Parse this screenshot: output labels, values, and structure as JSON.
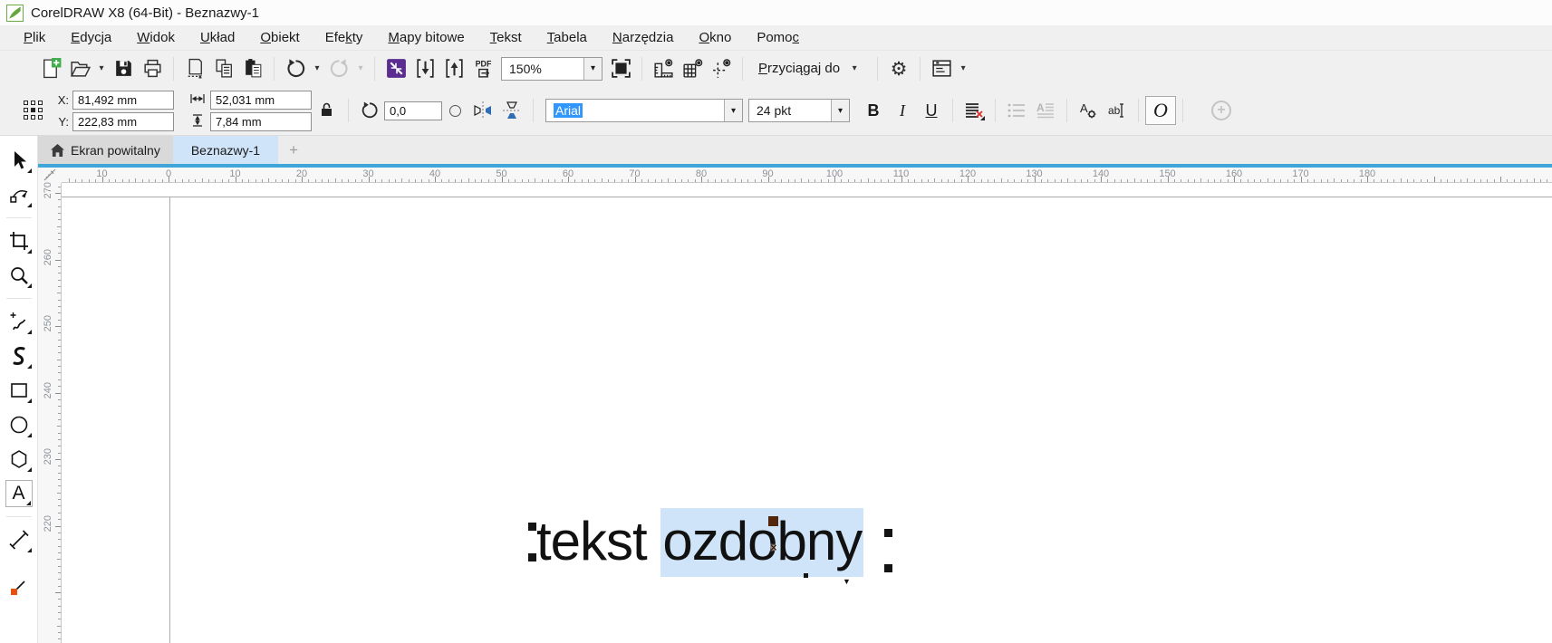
{
  "window": {
    "title": "CorelDRAW X8 (64-Bit) - Beznazwy-1"
  },
  "icons": {
    "dropdown": "▾",
    "gear": "⚙",
    "triangle_down": "▼",
    "x_marker": "×",
    "plus": "+"
  },
  "menu": {
    "items": [
      {
        "text": "Plik",
        "u": 0
      },
      {
        "text": "Edycja",
        "u": 0
      },
      {
        "text": "Widok",
        "u": 0
      },
      {
        "text": "Układ",
        "u": 0
      },
      {
        "text": "Obiekt",
        "u": 0
      },
      {
        "text": "Efekty",
        "u": 3
      },
      {
        "text": "Mapy bitowe",
        "u": 0
      },
      {
        "text": "Tekst",
        "u": 0
      },
      {
        "text": "Tabela",
        "u": 0
      },
      {
        "text": "Narzędzia",
        "u": 0
      },
      {
        "text": "Okno",
        "u": 0
      },
      {
        "text": "Pomoc",
        "u": 4
      }
    ]
  },
  "toolbar": {
    "zoom_level": "150%",
    "snap": {
      "text": "Przyciągaj do",
      "u": 0
    },
    "pdf_label": "PDF"
  },
  "propbar": {
    "x_label": "X:",
    "x_value": "81,492 mm",
    "y_label": "Y:",
    "y_value": "222,83 mm",
    "width_value": "52,031 mm",
    "height_value": "7,84 mm",
    "rotation_value": "0,0",
    "font_name": "Arial",
    "font_size": "24 pkt",
    "bold_label": "B",
    "italic_label": "I",
    "underline_label": "U",
    "char_format_label": "A",
    "edit_text_label": "ab",
    "o_button_label": "O"
  },
  "tabs": {
    "welcome": "Ekran powitalny",
    "document": "Beznazwy-1",
    "new_tab": "+"
  },
  "rulers": {
    "horizontal": {
      "labels": [
        "10",
        "0",
        "10",
        "20",
        "30",
        "40",
        "50",
        "60",
        "70",
        "80",
        "90",
        "100",
        "110",
        "120",
        "130",
        "140",
        "150",
        "160",
        "170",
        "180"
      ]
    },
    "vertical": {
      "labels": [
        "270",
        "260",
        "250",
        "240",
        "230",
        "220"
      ]
    }
  },
  "canvas": {
    "text_before": "tekst ",
    "text_selected": "ozdobny"
  }
}
